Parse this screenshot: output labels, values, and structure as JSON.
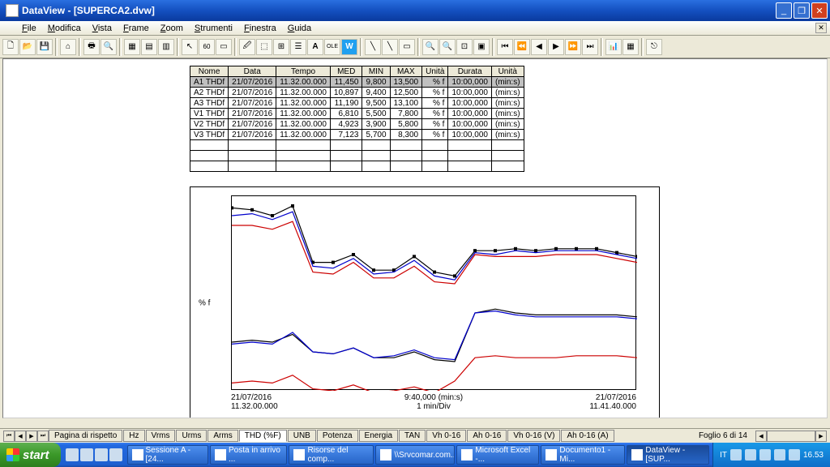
{
  "window": {
    "app_name": "DataView",
    "document": "[SUPERCA2.dvw]"
  },
  "menu": [
    "File",
    "Modifica",
    "Vista",
    "Frame",
    "Zoom",
    "Strumenti",
    "Finestra",
    "Guida"
  ],
  "table": {
    "headers": [
      "Nome",
      "Data",
      "Tempo",
      "MED",
      "MIN",
      "MAX",
      "Unità",
      "Durata",
      "Unità"
    ],
    "rows": [
      {
        "hl": true,
        "cells": [
          "A1 THDf",
          "21/07/2016",
          "11.32.00.000",
          "11,450",
          "9,800",
          "13,500",
          "% f",
          "10:00,000",
          "(min:s)"
        ]
      },
      {
        "hl": false,
        "cells": [
          "A2 THDf",
          "21/07/2016",
          "11.32.00.000",
          "10,897",
          "9,400",
          "12,500",
          "% f",
          "10:00,000",
          "(min:s)"
        ]
      },
      {
        "hl": false,
        "cells": [
          "A3 THDf",
          "21/07/2016",
          "11.32.00.000",
          "11,190",
          "9,500",
          "13,100",
          "% f",
          "10:00,000",
          "(min:s)"
        ]
      },
      {
        "hl": false,
        "cells": [
          "V1 THDf",
          "21/07/2016",
          "11.32.00.000",
          "6,810",
          "5,500",
          "7,800",
          "% f",
          "10:00,000",
          "(min:s)"
        ]
      },
      {
        "hl": false,
        "cells": [
          "V2 THDf",
          "21/07/2016",
          "11.32.00.000",
          "4,923",
          "3,900",
          "5,800",
          "% f",
          "10:00,000",
          "(min:s)"
        ]
      },
      {
        "hl": false,
        "cells": [
          "V3 THDf",
          "21/07/2016",
          "11.32.00.000",
          "7,123",
          "5,700",
          "8,300",
          "% f",
          "10:00,000",
          "(min:s)"
        ]
      }
    ],
    "empty_rows": 3
  },
  "chart_data": {
    "type": "line",
    "ylabel": "% f",
    "ymin": 4,
    "ymax": 14,
    "yticks": [
      4,
      5,
      6,
      7,
      8,
      9,
      10,
      11,
      12,
      13,
      14
    ],
    "xlabels_left": [
      "21/07/2016",
      "11.32.00.000"
    ],
    "xlabels_center": [
      "9:40,000 (min:s)",
      "1 min/Div"
    ],
    "xlabels_right": [
      "21/07/2016",
      "11.41.40.000"
    ],
    "series": [
      {
        "name": "A1",
        "color": "#000",
        "markers": true,
        "values": [
          13.4,
          13.3,
          13.0,
          13.5,
          10.6,
          10.6,
          11.0,
          10.2,
          10.2,
          10.9,
          10.1,
          9.9,
          11.2,
          11.2,
          11.3,
          11.2,
          11.3,
          11.3,
          11.3,
          11.1,
          10.9
        ]
      },
      {
        "name": "A2",
        "color": "#c00",
        "markers": false,
        "values": [
          12.5,
          12.5,
          12.3,
          12.7,
          10.1,
          10.0,
          10.6,
          9.8,
          9.8,
          10.4,
          9.6,
          9.5,
          11.0,
          10.9,
          10.9,
          10.9,
          11.0,
          11.0,
          11.0,
          10.8,
          10.6
        ]
      },
      {
        "name": "A3",
        "color": "#00c",
        "markers": false,
        "values": [
          13.0,
          13.1,
          12.8,
          13.2,
          10.4,
          10.3,
          10.8,
          10.0,
          10.1,
          10.7,
          9.9,
          9.7,
          11.1,
          11.0,
          11.2,
          11.1,
          11.2,
          11.2,
          11.2,
          11.0,
          10.8
        ]
      },
      {
        "name": "V1",
        "color": "#000",
        "markers": false,
        "values": [
          6.5,
          6.6,
          6.5,
          6.9,
          6.0,
          5.9,
          6.2,
          5.7,
          5.7,
          6.0,
          5.6,
          5.5,
          8.0,
          8.2,
          8.0,
          7.9,
          7.9,
          7.9,
          7.9,
          7.9,
          7.8
        ]
      },
      {
        "name": "V2",
        "color": "#c00",
        "markers": false,
        "values": [
          4.4,
          4.5,
          4.4,
          4.8,
          4.1,
          4.0,
          4.3,
          3.9,
          4.0,
          4.2,
          3.9,
          4.5,
          5.7,
          5.8,
          5.7,
          5.7,
          5.7,
          5.8,
          5.8,
          5.8,
          5.7
        ]
      },
      {
        "name": "V3",
        "color": "#00c",
        "markers": false,
        "values": [
          6.4,
          6.5,
          6.4,
          7.0,
          6.0,
          5.9,
          6.2,
          5.7,
          5.8,
          6.1,
          5.7,
          5.6,
          8.0,
          8.1,
          7.9,
          7.8,
          7.8,
          7.8,
          7.8,
          7.8,
          7.7
        ]
      }
    ]
  },
  "bottom_tabs": {
    "left": "Pagina di rispetto",
    "tabs": [
      "Hz",
      "Vrms",
      "Urms",
      "Arms",
      "THD (%F)",
      "UNB",
      "Potenza",
      "Energia",
      "TAN",
      "Vh 0-16",
      "Ah 0-16",
      "Vh 0-16 (V)",
      "Ah 0-16 (A)"
    ],
    "active_index": 4,
    "page_indicator": "Foglio 6 di 14"
  },
  "taskbar": {
    "start": "start",
    "items": [
      "Sessione A - [24...",
      "Posta in arrivo ...",
      "Risorse del comp...",
      "\\\\Srvcomar.com...",
      "Microsoft Excel -...",
      "Documento1 - Mi...",
      "DataView - [SUP..."
    ],
    "active_index": 6,
    "lang": "IT",
    "clock": "16.53"
  }
}
